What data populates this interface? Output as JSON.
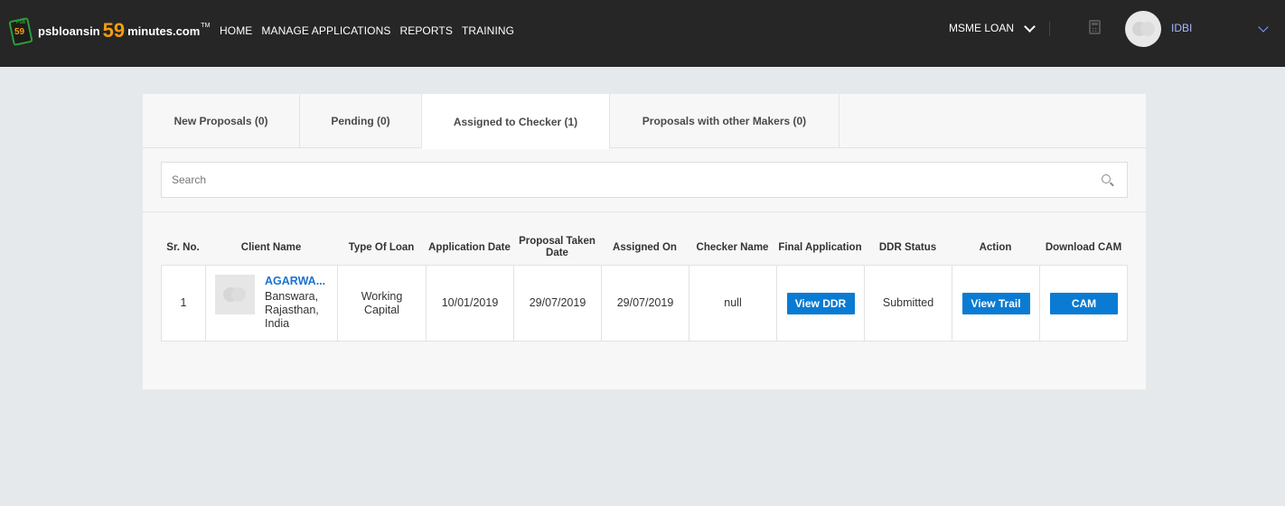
{
  "header": {
    "logo": {
      "badge_num": "59",
      "badge_top": "PSB",
      "text1": "psbloansin",
      "num": "59",
      "text2": "minutes.com",
      "tm": "TM"
    },
    "nav": [
      "HOME",
      "MANAGE APPLICATIONS",
      "REPORTS",
      "TRAINING"
    ],
    "loan_type": "MSME LOAN",
    "user_name": "IDBI"
  },
  "tabs": [
    {
      "label": "New Proposals (0)"
    },
    {
      "label": "Pending (0)"
    },
    {
      "label": "Assigned to Checker (1)"
    },
    {
      "label": "Proposals with other Makers (0)"
    }
  ],
  "active_tab": "Assigned to Checker (1)",
  "search": {
    "placeholder": "Search",
    "value": ""
  },
  "table": {
    "headers": [
      "Sr. No.",
      "Client Name",
      "Type Of Loan",
      "Application Date",
      "Proposal Taken Date",
      "Assigned On",
      "Checker Name",
      "Final Application",
      "DDR Status",
      "Action",
      "Download CAM"
    ],
    "rows": [
      {
        "sr_no": "1",
        "client_name": "AGARWA...",
        "client_location": "Banswara, Rajasthan, India",
        "loan_type": "Working Capital",
        "application_date": "10/01/2019",
        "proposal_taken_date": "29/07/2019",
        "assigned_on": "29/07/2019",
        "checker_name": "null",
        "final_application_button": "View DDR",
        "ddr_status": "Submitted",
        "action_button": "View Trail",
        "download_cam_button": "CAM"
      }
    ]
  },
  "colors": {
    "header_bg": "#262626",
    "accent": "#0a7bd3",
    "logo_orange": "#f39c12",
    "user_name": "#a9b6ff"
  }
}
